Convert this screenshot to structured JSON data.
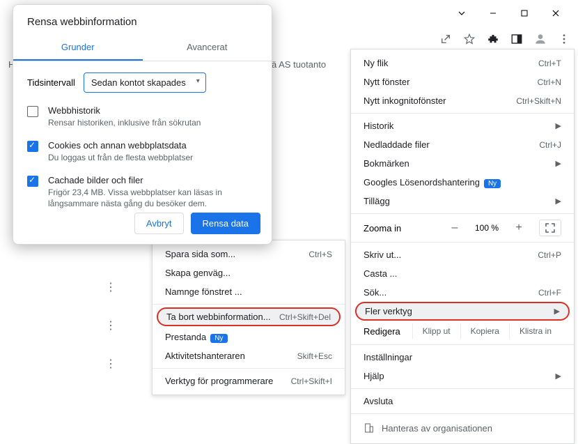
{
  "window": {
    "minimize": "–",
    "maximize": "▢",
    "close": "✕"
  },
  "bg": {
    "tuotanto": "ä AS tuotanto",
    "h": "H"
  },
  "dialog": {
    "title": "Rensa webbinformation",
    "tabs": {
      "basic": "Grunder",
      "advanced": "Avancerat"
    },
    "time_label": "Tidsintervall",
    "time_value": "Sedan kontot skapades",
    "items": [
      {
        "title": "Webbhistorik",
        "sub": "Rensar historiken, inklusive från sökrutan",
        "checked": false
      },
      {
        "title": "Cookies och annan webbplatsdata",
        "sub": "Du loggas ut från de flesta webbplatser",
        "checked": true
      },
      {
        "title": "Cachade bilder och filer",
        "sub": "Frigör 23,4 MB. Vissa webbplatser kan läsas in långsammare nästa gång du besöker dem.",
        "checked": true
      }
    ],
    "cancel": "Avbryt",
    "confirm": "Rensa data"
  },
  "menu": {
    "new_tab": "Ny flik",
    "new_tab_sc": "Ctrl+T",
    "new_window": "Nytt fönster",
    "new_window_sc": "Ctrl+N",
    "incognito": "Nytt inkognitofönster",
    "incognito_sc": "Ctrl+Skift+N",
    "history": "Historik",
    "downloads": "Nedladdade filer",
    "downloads_sc": "Ctrl+J",
    "bookmarks": "Bokmärken",
    "passwords": "Googles Lösenordshantering",
    "ny": "Ny",
    "extensions": "Tillägg",
    "zoom": "Zooma in",
    "zoom_pct": "100 %",
    "print": "Skriv ut...",
    "print_sc": "Ctrl+P",
    "cast": "Casta ...",
    "find": "Sök...",
    "find_sc": "Ctrl+F",
    "more_tools": "Fler verktyg",
    "edit": "Redigera",
    "cut": "Klipp ut",
    "copy": "Kopiera",
    "paste": "Klistra in",
    "settings": "Inställningar",
    "help": "Hjälp",
    "exit": "Avsluta",
    "managed": "Hanteras av organisationen"
  },
  "submenu": {
    "save_as": "Spara sida som...",
    "save_as_sc": "Ctrl+S",
    "shortcut": "Skapa genväg...",
    "name_window": "Namnge fönstret ...",
    "clear_data": "Ta bort webbinformation...",
    "clear_data_sc": "Ctrl+Skift+Del",
    "perf": "Prestanda",
    "task_mgr": "Aktivitetshanteraren",
    "task_mgr_sc": "Skift+Esc",
    "dev_tools": "Verktyg för programmerare",
    "dev_tools_sc": "Ctrl+Skift+I"
  }
}
